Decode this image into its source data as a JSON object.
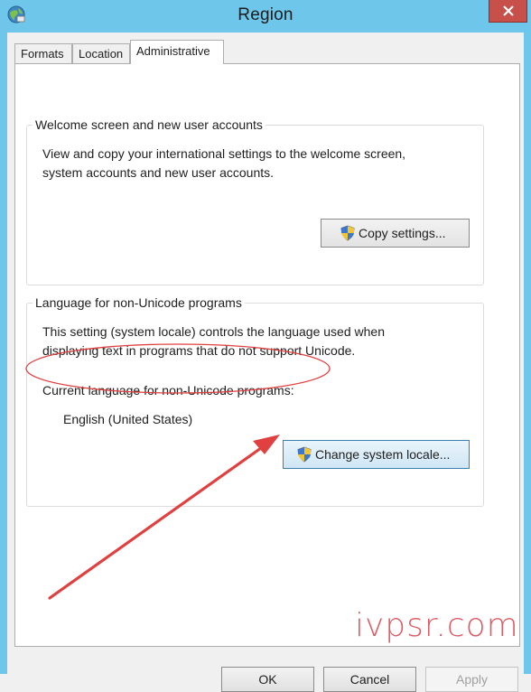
{
  "window": {
    "title": "Region",
    "icon": "globe-icon",
    "close_icon": "close-icon"
  },
  "tabs": [
    {
      "label": "Formats",
      "active": false
    },
    {
      "label": "Location",
      "active": false
    },
    {
      "label": "Administrative",
      "active": true
    }
  ],
  "welcome_group": {
    "title": "Welcome screen and new user accounts",
    "line1": "View and copy your international settings to the welcome screen,",
    "line2": "system accounts and new user accounts.",
    "button_label": "Copy settings..."
  },
  "unicode_group": {
    "title": "Language for non-Unicode programs",
    "line1": "This setting (system locale) controls the language used when",
    "line2": "displaying text in programs that do not support Unicode.",
    "current_label": "Current language for non-Unicode programs:",
    "current_value": "English (United States)",
    "button_label": "Change system locale..."
  },
  "dialog_buttons": {
    "ok": "OK",
    "cancel": "Cancel",
    "apply": "Apply"
  },
  "watermark": "ivpsr.com",
  "colors": {
    "titlebar": "#6ec6ea",
    "close": "#c7504a",
    "annotation": "#e0403f"
  }
}
